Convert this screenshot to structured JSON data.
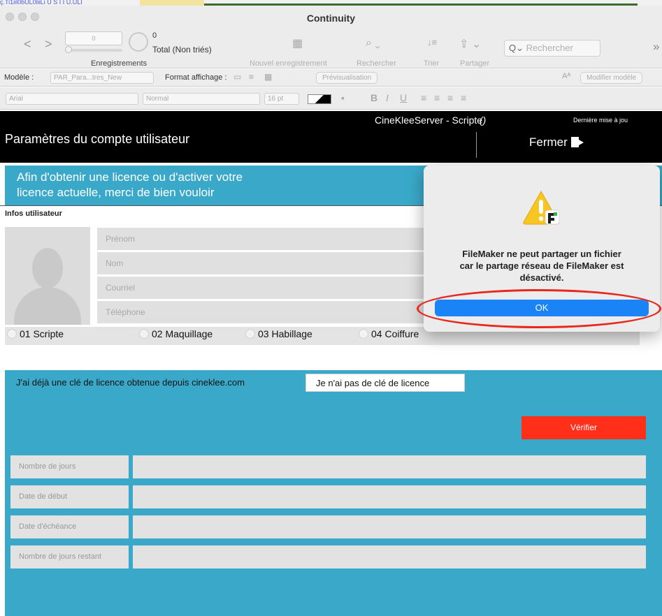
{
  "window": {
    "top_link": "ç.Ti1iil0bUL0liiLi U S I I U.ULI",
    "title": "Continuity",
    "nav_back": "<",
    "nav_forward": ">"
  },
  "records": {
    "current_value": "0",
    "count": "0",
    "total_label": "Total (Non triés)",
    "group_label": "Enregistrements"
  },
  "toolbar": {
    "new_record": "Nouvel enregistrement",
    "find": "Rechercher",
    "sort": "Trier",
    "share": "Partager",
    "search_placeholder": "Rechercher",
    "more": "»"
  },
  "layout_bar": {
    "model_label": "Modèle :",
    "model_value": "PAR_Para...tres_New",
    "view_label": "Format affichage :",
    "preview": "Prévisualisation",
    "text_size_icon": "Aᴬ",
    "edit_layout": "Modifier modèle"
  },
  "format_bar": {
    "font": "Arial",
    "style": "Normal",
    "size": "16 pt",
    "bold": "B",
    "italic": "I",
    "underline": "U"
  },
  "header": {
    "title": "Paramètres du compte utilisateur",
    "app": "CineKleeServer - Scripte",
    "cursor": "()",
    "last_update": "Dernière mise à jou",
    "close": "Fermer"
  },
  "banner": {
    "line1": "Afin d'obtenir une licence ou d'activer votre",
    "line2": "licence actuelle, merci de bien vouloir"
  },
  "user_info": {
    "title": "Infos utilisateur",
    "fields": [
      "Prénom",
      "Nom",
      "Courriel",
      "Téléphone"
    ]
  },
  "roles": [
    "01  Scripte",
    "02  Maquillage",
    "03  Habillage",
    "04  Coiffure"
  ],
  "license": {
    "tab_have_key": "J'ai déjà une clé de licence obtenue depuis cineklee.com",
    "tab_no_key": "Je n'ai pas de clé de licence",
    "verify": "Vérifier",
    "fields": [
      "Nombre de jours",
      "Date de début",
      "Date d'échéance",
      "Nombre de jours restant"
    ]
  },
  "dialog": {
    "message": "FileMaker ne peut partager un fichier\ncar le partage réseau de FileMaker est\ndésactivé.",
    "ok": "OK",
    "icon": "warning-filemaker-icon"
  },
  "colors": {
    "teal": "#3aa9c9",
    "verify_red": "#ff2f1a",
    "ok_blue": "#1a84f7",
    "highlight_ring": "#e8281c"
  }
}
